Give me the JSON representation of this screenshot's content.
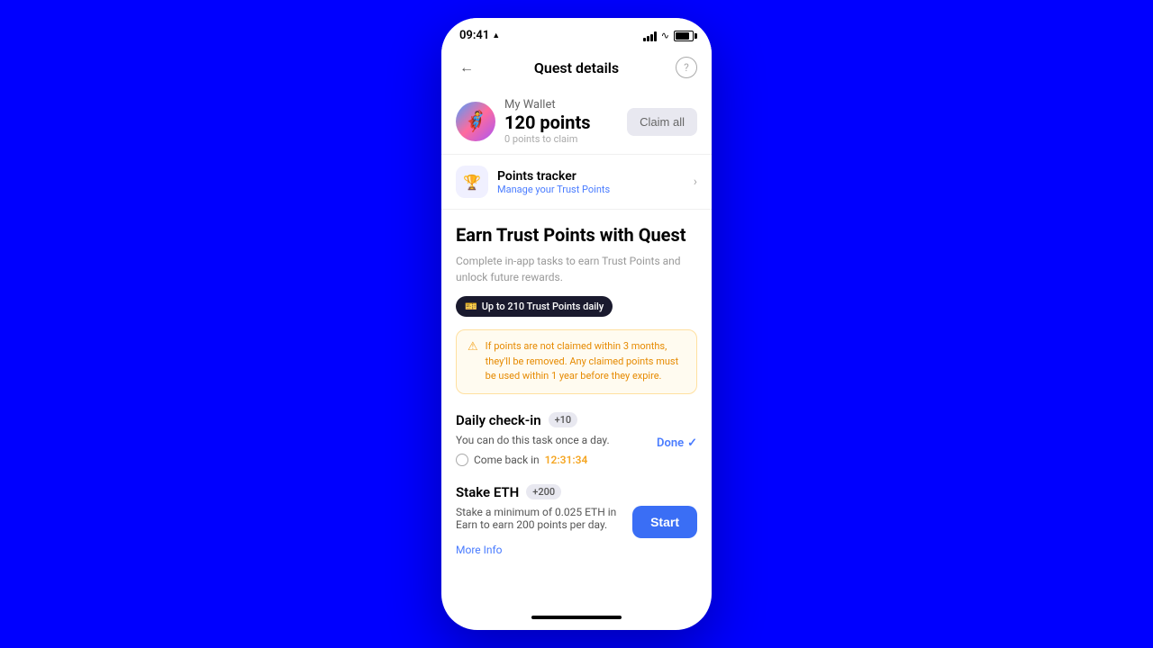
{
  "statusBar": {
    "time": "09:41",
    "navArrow": "➤"
  },
  "header": {
    "title": "Quest details",
    "helpLabel": "?"
  },
  "wallet": {
    "name": "My Wallet",
    "points": "120 points",
    "claimText": "0 points",
    "claimSuffix": "to claim",
    "claimAllLabel": "Claim all"
  },
  "pointsTracker": {
    "title": "Points tracker",
    "subtitle": "Manage your Trust Points"
  },
  "quest": {
    "title": "Earn Trust Points with Quest",
    "description": "Complete in-app tasks to earn Trust Points and unlock future rewards.",
    "badgeLabel": "Up to 210 Trust Points daily"
  },
  "warning": {
    "text": "If points are not claimed within 3 months, they'll be removed. Any claimed points must be used within 1 year before they expire."
  },
  "tasks": {
    "checkin": {
      "title": "Daily check-in",
      "points": "+10",
      "description": "You can do this task once a day.",
      "doneLabel": "Done",
      "comeBackLabel": "Come back in",
      "timer": "12:31:34"
    },
    "stake": {
      "title": "Stake ETH",
      "points": "+200",
      "description": "Stake a minimum of 0.025 ETH in Earn to earn 200 points per day.",
      "startLabel": "Start",
      "moreInfoLabel": "More Info"
    }
  }
}
